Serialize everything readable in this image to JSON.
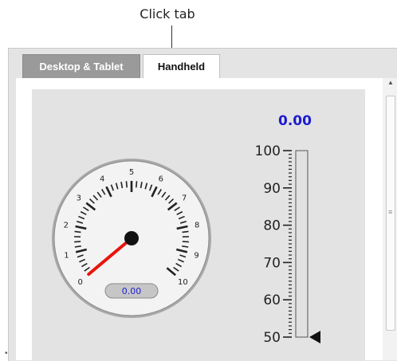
{
  "callout": {
    "text": "Click tab"
  },
  "tabs": [
    {
      "label": "Desktop & Tablet",
      "active": false
    },
    {
      "label": "Handheld",
      "active": true
    }
  ],
  "linear_gauge": {
    "reading": "0.00",
    "min": 50,
    "max": 100,
    "value": 50,
    "major_labels": [
      "100",
      "90",
      "80",
      "70",
      "60",
      "50"
    ]
  },
  "dial_gauge": {
    "labels": [
      "0",
      "1",
      "2",
      "3",
      "4",
      "5",
      "6",
      "7",
      "8",
      "9",
      "10"
    ],
    "min": 0,
    "max": 10,
    "value": 0,
    "readout": "0.00",
    "needle_color": "#e8140c",
    "readout_color": "#1c1ccf"
  },
  "colors": {
    "reading": "#1c1ccf",
    "panel": "#e3e3e3"
  }
}
